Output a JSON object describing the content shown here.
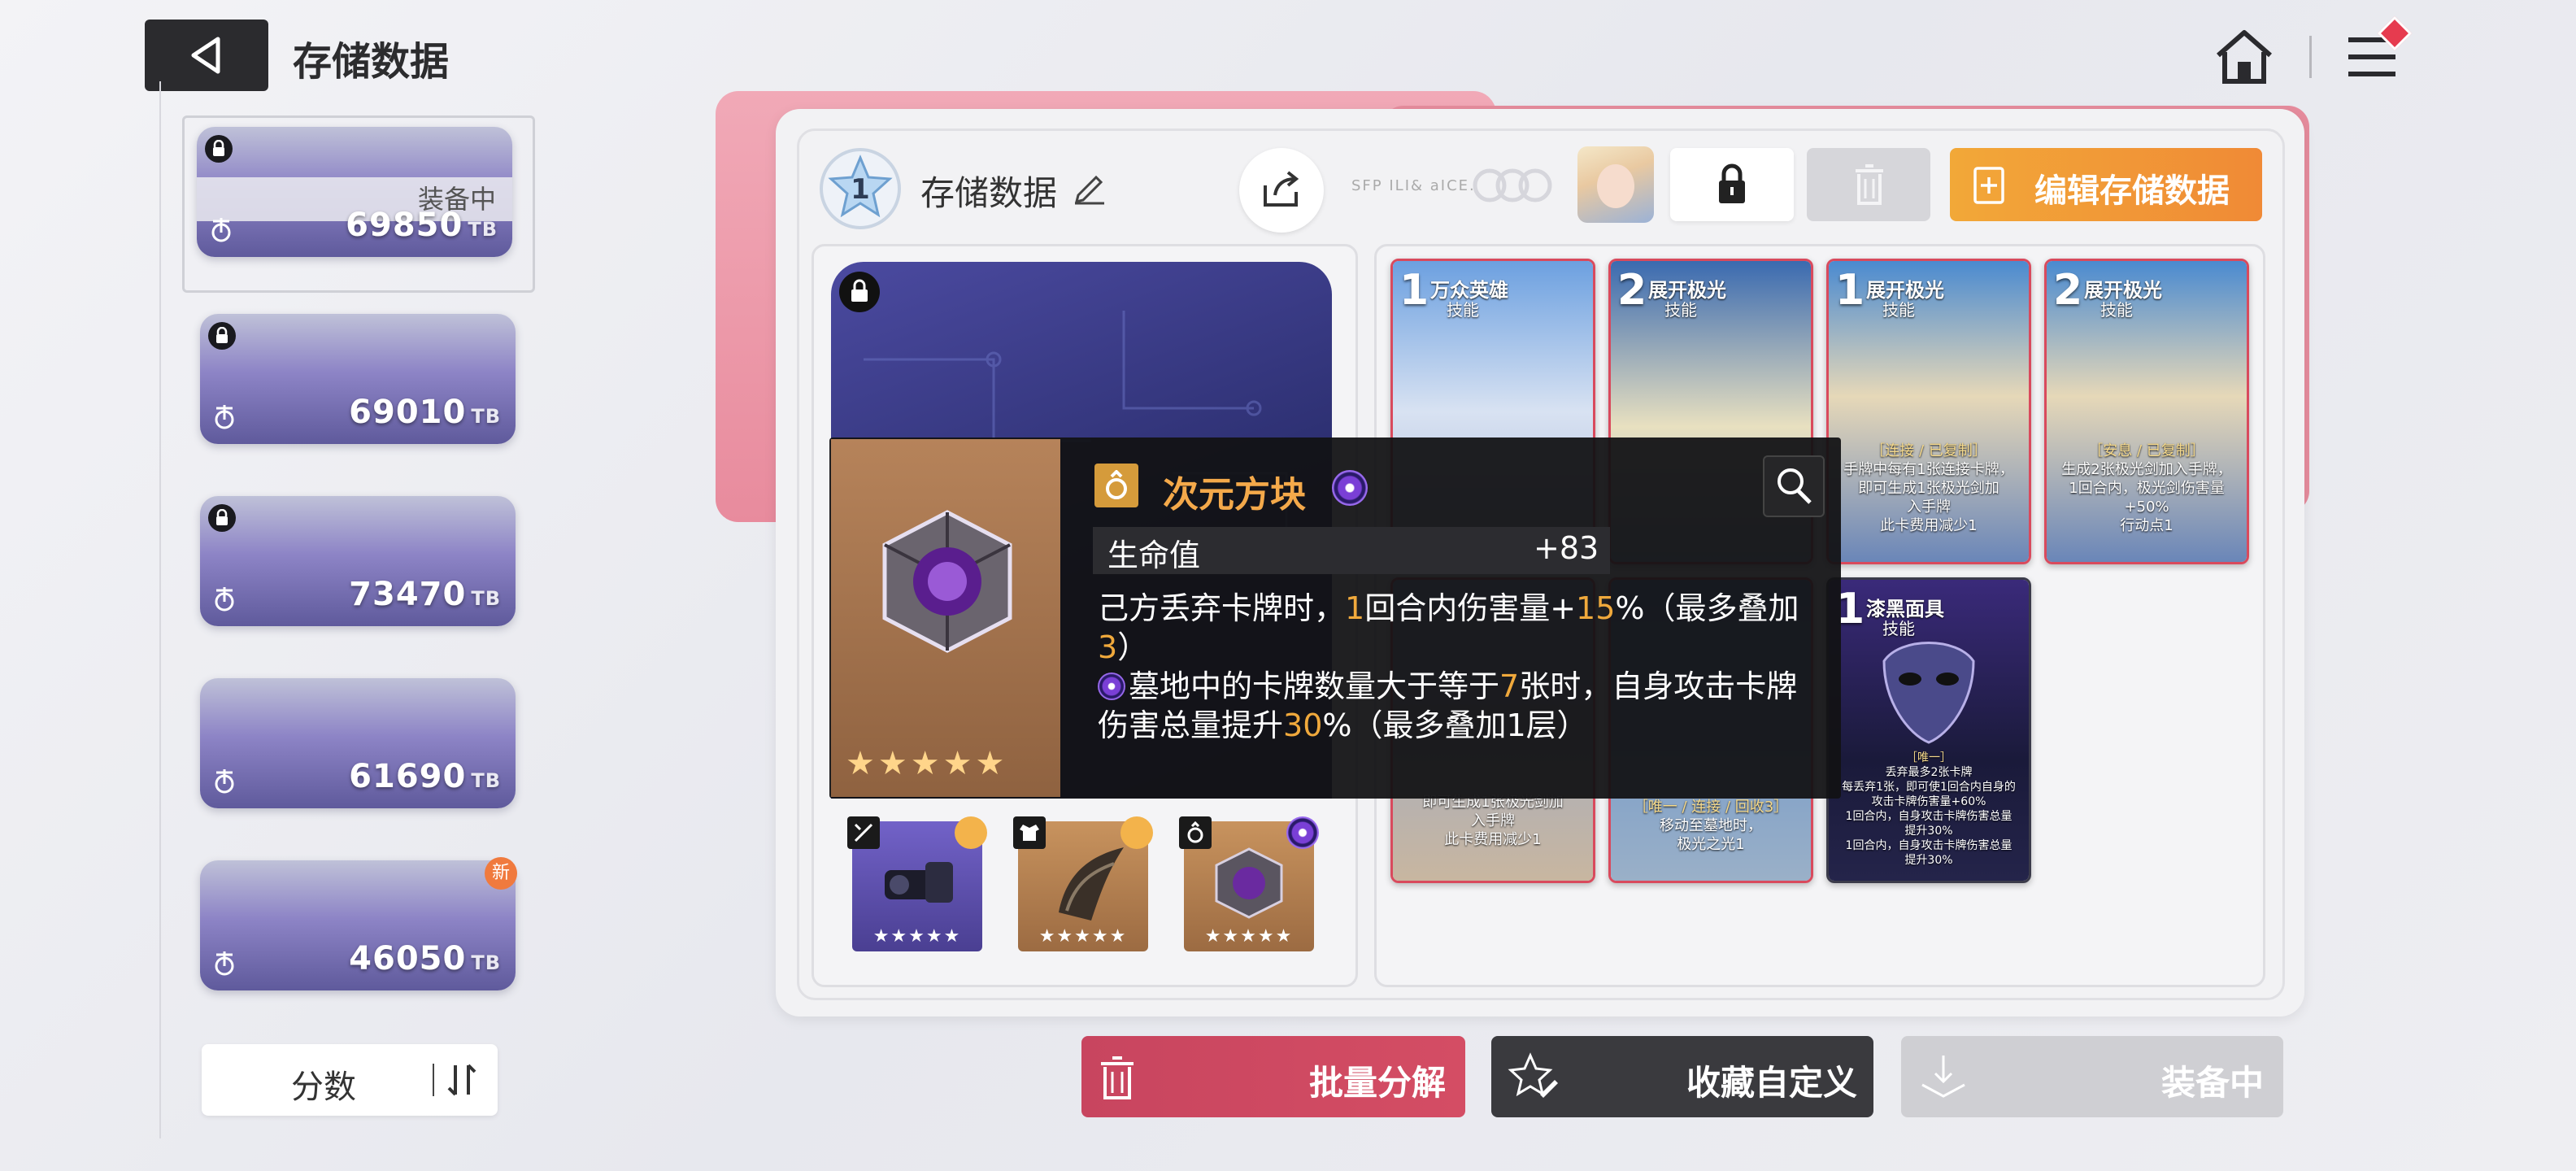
{
  "header": {
    "title": "存储数据"
  },
  "sidebar": {
    "slots": [
      {
        "score": "69850",
        "unit": "TB",
        "status": "装备中",
        "locked": true,
        "selected": true
      },
      {
        "score": "69010",
        "unit": "TB",
        "locked": true
      },
      {
        "score": "73470",
        "unit": "TB",
        "locked": true
      },
      {
        "score": "61690",
        "unit": "TB",
        "locked": false
      },
      {
        "score": "46050",
        "unit": "TB",
        "locked": false,
        "badge": "新"
      }
    ],
    "sort_label": "分数"
  },
  "panel": {
    "level": "1",
    "name": "存储数据",
    "deco_text": "SFP ILI& aICE.",
    "edit_label": "编辑存储数据"
  },
  "cards": [
    {
      "cost": "1",
      "name": "万众英雄",
      "type": "技能",
      "desc": [],
      "frame": "#d94a5d"
    },
    {
      "cost": "2",
      "name": "展开极光",
      "type": "技能",
      "desc": [],
      "frame": "#d94a5d"
    },
    {
      "cost": "1",
      "name": "展开极光",
      "type": "技能",
      "desc": [
        "［连接 / 已复制］",
        "手牌中每有1张连接卡牌，",
        "即可生成1张极光剑加",
        "入手牌",
        "此卡费用减少1"
      ],
      "frame": "#d94a5d"
    },
    {
      "cost": "2",
      "name": "展开极光",
      "type": "技能",
      "desc": [
        "［安息 / 已复制］",
        "生成2张极光剑加入手牌，",
        "1回合内，极光剑伤害量",
        "+50%",
        "行动点1"
      ],
      "frame": "#d94a5d"
    },
    {
      "cost": "",
      "name": "",
      "type": "",
      "desc": [
        "即可生成1张极光剑加",
        "入手牌",
        "此卡费用减少1"
      ],
      "frame": "#d94a5d"
    },
    {
      "cost": "",
      "name": "",
      "type": "",
      "desc": [
        "［唯一 / 连接 / 回收3］",
        "移动至墓地时，",
        "极光之光1"
      ],
      "frame": "#d94a5d"
    },
    {
      "cost": "1",
      "name": "漆黑面具",
      "type": "技能",
      "desc": [
        "［唯一］",
        "丢弃最多2张卡牌",
        "每丢弃1张，即可使1回合内自身的",
        "攻击卡牌伤害量+60%",
        "1回合内，自身攻击卡牌伤害总量",
        "提升30%",
        "1回合内，自身攻击卡牌伤害总量",
        "提升30%"
      ],
      "frame": "#3b3b4a"
    }
  ],
  "equipment": [
    {
      "slot": "weapon-icon",
      "stars": "★★★★★",
      "bg": "#6a5ab4"
    },
    {
      "slot": "armor-icon",
      "stars": "★★★★★",
      "bg": "#b88558"
    },
    {
      "slot": "ring-icon",
      "stars": "★★★★★",
      "bg": "#b88558"
    }
  ],
  "tooltip": {
    "name": "次元方块",
    "stars": "★★★★★",
    "stat_label": "生命值",
    "stat_value": "+83",
    "desc1_parts": [
      "己方丢弃卡牌时，",
      "1",
      "回合内伤害量+",
      "15",
      "%（最多叠加",
      "3",
      "）"
    ],
    "desc2_parts": [
      "墓地中的卡牌数量大于等于",
      "7",
      "张时，自身攻击卡牌伤害总量提升",
      "30",
      "%（最多叠加1层）"
    ]
  },
  "buttons": {
    "decompose": "批量分解",
    "favorite": "收藏自定义",
    "equip": "装备中"
  }
}
